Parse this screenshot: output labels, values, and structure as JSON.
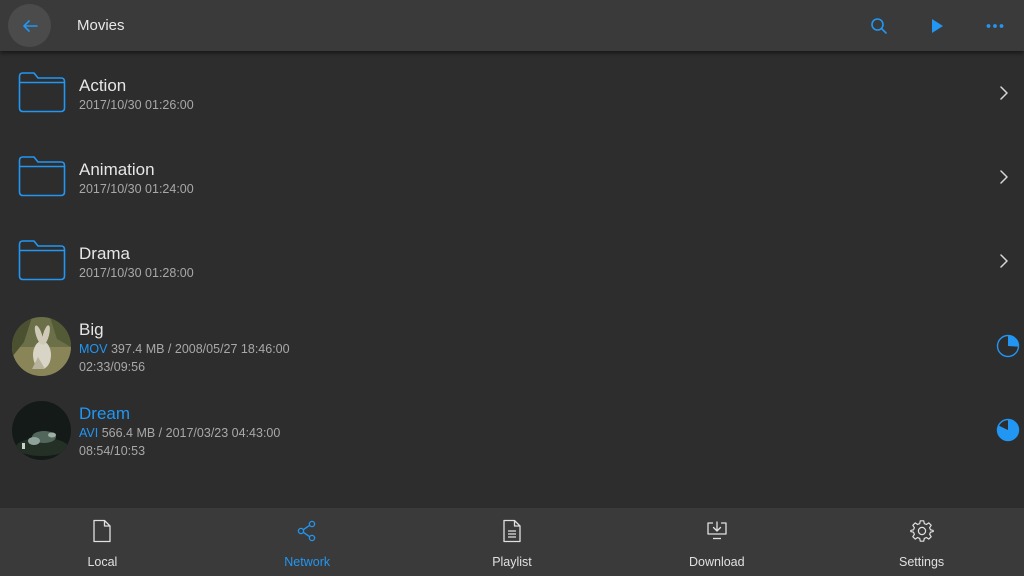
{
  "header": {
    "title": "Movies",
    "icons": {
      "back": "arrow-left-icon",
      "search": "search-icon",
      "play": "play-icon",
      "more": "more-horizontal-icon"
    }
  },
  "folders": [
    {
      "name": "Action",
      "date": "2017/10/30 01:26:00"
    },
    {
      "name": "Animation",
      "date": "2017/10/30 01:24:00"
    },
    {
      "name": "Drama",
      "date": "2017/10/30 01:28:00"
    }
  ],
  "videos": [
    {
      "name": "Big",
      "format": "MOV",
      "details": " 397.4 MB / 2008/05/27 18:46:00",
      "position": "02:33/09:56",
      "progress": 0.26,
      "highlighted": false
    },
    {
      "name": "Dream",
      "format": "AVI",
      "details": " 566.4 MB / 2017/03/23 04:43:00",
      "position": "08:54/10:53",
      "progress": 0.82,
      "highlighted": true
    }
  ],
  "bottom_nav": [
    {
      "label": "Local",
      "icon": "file-icon",
      "active": false
    },
    {
      "label": "Network",
      "icon": "share-icon",
      "active": true
    },
    {
      "label": "Playlist",
      "icon": "document-list-icon",
      "active": false
    },
    {
      "label": "Download",
      "icon": "download-icon",
      "active": false
    },
    {
      "label": "Settings",
      "icon": "gear-icon",
      "active": false
    }
  ],
  "colors": {
    "accent": "#2196f3",
    "background": "#2d2d2d",
    "bar": "#3a3a3a"
  }
}
